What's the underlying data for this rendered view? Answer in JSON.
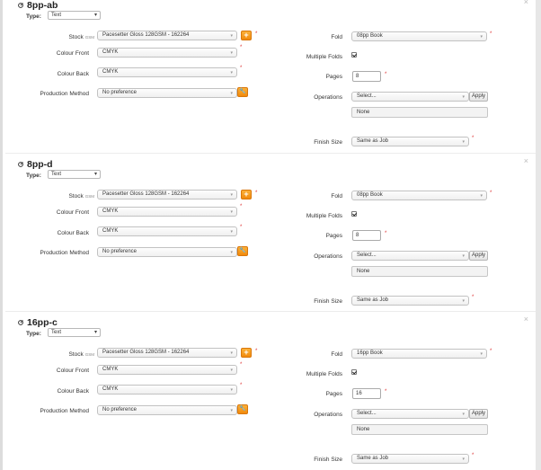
{
  "sections": [
    {
      "title": "8pp-ab",
      "type_label": "Type:",
      "type_value": "Text",
      "stock_label": "Stock",
      "stock_sub": "GSM",
      "stock_value": "Pacesetter Gloss 128GSM - 162264",
      "colour_front_label": "Colour Front",
      "colour_front_value": "CMYK",
      "colour_back_label": "Colour Back",
      "colour_back_value": "CMYK",
      "production_label": "Production Method",
      "production_value": "No preference",
      "fold_label": "Fold",
      "fold_value": "08pp Book",
      "multiple_folds_label": "Multiple Folds",
      "pages_label": "Pages",
      "pages_value": "8",
      "operations_label": "Operations",
      "operations_placeholder": "Select...",
      "apply_label": "Apply",
      "operations_selected": "None",
      "finish_label": "Finish Size",
      "finish_value": "Same as Job"
    },
    {
      "title": "8pp-d",
      "type_label": "Type:",
      "type_value": "Text",
      "stock_label": "Stock",
      "stock_sub": "GSM",
      "stock_value": "Pacesetter Gloss 128GSM - 162264",
      "colour_front_label": "Colour Front",
      "colour_front_value": "CMYK",
      "colour_back_label": "Colour Back",
      "colour_back_value": "CMYK",
      "production_label": "Production Method",
      "production_value": "No preference",
      "fold_label": "Fold",
      "fold_value": "08pp Book",
      "multiple_folds_label": "Multiple Folds",
      "pages_label": "Pages",
      "pages_value": "8",
      "operations_label": "Operations",
      "operations_placeholder": "Select...",
      "apply_label": "Apply",
      "operations_selected": "None",
      "finish_label": "Finish Size",
      "finish_value": "Same as Job"
    },
    {
      "title": "16pp-c",
      "type_label": "Type:",
      "type_value": "Text",
      "stock_label": "Stock",
      "stock_sub": "GSM",
      "stock_value": "Pacesetter Gloss 128GSM - 162264",
      "colour_front_label": "Colour Front",
      "colour_front_value": "CMYK",
      "colour_back_label": "Colour Back",
      "colour_back_value": "CMYK",
      "production_label": "Production Method",
      "production_value": "No preference",
      "fold_label": "Fold",
      "fold_value": "16pp Book",
      "multiple_folds_label": "Multiple Folds",
      "pages_label": "Pages",
      "pages_value": "16",
      "operations_label": "Operations",
      "operations_placeholder": "Select...",
      "apply_label": "Apply",
      "operations_selected": "None",
      "finish_label": "Finish Size",
      "finish_value": "Same as Job"
    }
  ],
  "icons": {
    "close": "close-icon",
    "edit": "edit-icon",
    "add": "plus-icon",
    "wrench": "wrench-icon",
    "caret": "chevron-down-icon"
  },
  "colors": {
    "accent_orange": "#f39a1e",
    "required_red": "#d33333"
  },
  "glyphs": {
    "close": "×",
    "plus": "+",
    "wrench": "🔧",
    "caret": "▾",
    "required": "*"
  }
}
